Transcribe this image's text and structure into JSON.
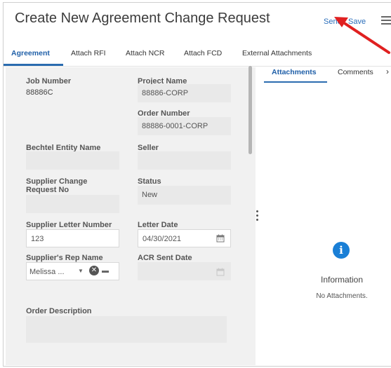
{
  "header": {
    "title": "Create New Agreement Change Request",
    "send_label": "Send",
    "save_label": "Save"
  },
  "tabs": [
    {
      "label": "Agreement",
      "active": true
    },
    {
      "label": "Attach RFI",
      "active": false
    },
    {
      "label": "Attach NCR",
      "active": false
    },
    {
      "label": "Attach FCD",
      "active": false
    },
    {
      "label": "External Attachments",
      "active": false
    }
  ],
  "form": {
    "job_number": {
      "label": "Job Number",
      "value": "88886C"
    },
    "project_name": {
      "label": "Project Name",
      "value": "88886-CORP"
    },
    "order_number": {
      "label": "Order Number",
      "value": "88886-0001-CORP"
    },
    "bechtel_entity_name": {
      "label": "Bechtel Entity Name",
      "value": ""
    },
    "seller": {
      "label": "Seller",
      "value": ""
    },
    "supplier_change_request_no": {
      "label_line1": "Supplier Change",
      "label_line2": "Request No",
      "value": ""
    },
    "status": {
      "label": "Status",
      "value": "New"
    },
    "supplier_letter_number": {
      "label": "Supplier Letter Number",
      "value": "123"
    },
    "letter_date": {
      "label": "Letter Date",
      "value": "04/30/2021"
    },
    "suppliers_rep_name": {
      "label": "Supplier's Rep Name",
      "value": "Melissa ..."
    },
    "acr_sent_date": {
      "label": "ACR Sent Date",
      "value": ""
    },
    "order_description": {
      "label": "Order Description",
      "value": ""
    }
  },
  "side_panel": {
    "tabs": [
      {
        "label": "Attachments",
        "active": true
      },
      {
        "label": "Comments",
        "active": false
      }
    ],
    "info_icon": "info-icon",
    "info_title": "Information",
    "info_message": "No Attachments."
  },
  "colors": {
    "accent": "#1f5fa8",
    "annotation_arrow": "#e02020",
    "info_icon": "#1a7fd6"
  }
}
